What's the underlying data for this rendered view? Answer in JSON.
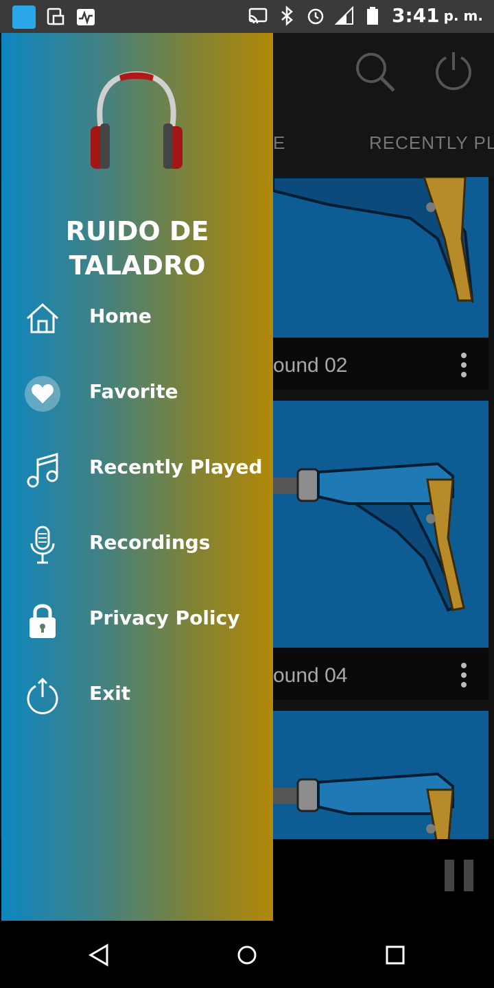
{
  "status_bar": {
    "time": "3:41",
    "ampm": "p. m.",
    "icons": [
      "app-icon",
      "screenshot-icon",
      "pulse-icon",
      "cast-icon",
      "bluetooth-icon",
      "alarm-icon",
      "signal-icon",
      "battery-icon"
    ]
  },
  "background": {
    "tabs": [
      "E",
      "RECENTLY PL"
    ],
    "cards": [
      {
        "title": "ound 02"
      },
      {
        "title": "ound 04"
      }
    ]
  },
  "drawer": {
    "app_title_line1": "RUIDO DE",
    "app_title_line2": "TALADRO",
    "menu": [
      {
        "label": "Home",
        "icon": "home-icon"
      },
      {
        "label": "Favorite",
        "icon": "heart-icon"
      },
      {
        "label": "Recently Played",
        "icon": "music-note-icon"
      },
      {
        "label": "Recordings",
        "icon": "microphone-icon"
      },
      {
        "label": "Privacy Policy",
        "icon": "lock-icon"
      },
      {
        "label": "Exit",
        "icon": "power-icon"
      }
    ]
  },
  "colors": {
    "drawer_gradient_start": "#0e86c0",
    "drawer_gradient_end": "#b28808",
    "card_image_bg": "#0d5c93"
  }
}
